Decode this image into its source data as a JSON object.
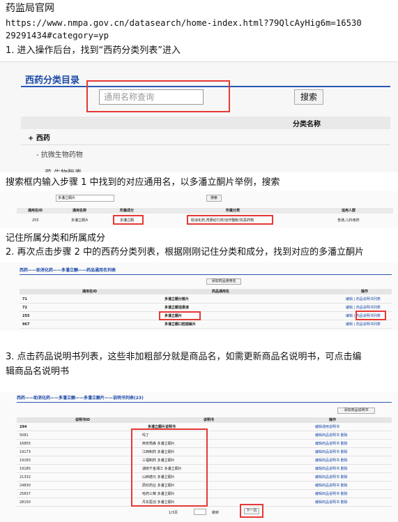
{
  "header": {
    "title": "药监局官网",
    "url_line1": "https://www.nmpa.gov.cn/datasearch/home-index.html?79QlcAyHig6m=16530",
    "url_line2": "29291434#category=yp"
  },
  "steps": {
    "step1": "1. 进入操作后台，找到“西药分类列表”进入",
    "search_note": "搜索框内输入步骤 1 中找到的对应通用名，以多潘立酮片举例，搜索",
    "remember_note": "记住所属分类和所属成分",
    "step2": "2. 再次点击步骤 2 中的西药分类列表，根据刚刚记住分类和成分，找到对应的多潘立酮片",
    "step3_line1": "3. 点击药品说明书列表，这些非加粗部分就是商品名，如需更新商品名说明书，可点击编",
    "step3_line2": "辑商品名说明书"
  },
  "shot1": {
    "title": "西药分类目录",
    "search_placeholder": "通用名称查询",
    "search_button": "搜索",
    "column_header": "分类名称",
    "tree_root": "+ 西药",
    "tree_child": "- 抗微生物药物",
    "tree_cut": "菜    生物酶素"
  },
  "shot2": {
    "search_value": "多潘立酮片",
    "search_button": "搜索",
    "headers": [
      "通用名ID",
      "通用名称",
      "所属成分",
      "所属分类",
      "适用人群"
    ],
    "row": [
      "255",
      "多潘立酮片",
      "多潘立酮",
      "助消化药,胃肠动力药/治疗腹胀/抗恶药物",
      "普通,儿科用药"
    ]
  },
  "shot3": {
    "breadcrumb": "西药——助消化药——多潘立酮——药品通用名列表",
    "add_button": "添加药品通用名",
    "headers": [
      "通用名ID",
      "药品通用名",
      "操作"
    ],
    "rows": [
      {
        "id": "71",
        "name": "多潘立酮分散片",
        "ops": "编辑 | 药品说明书列表"
      },
      {
        "id": "72",
        "name": "多潘立酮混悬液",
        "ops": "编辑 | 药品说明书列表"
      },
      {
        "id": "255",
        "name": "多潘立酮片",
        "ops": "编辑 | 药品说明书列表"
      },
      {
        "id": "967",
        "name": "多潘立酮口腔崩解片",
        "ops": "编辑 | 药品说明书列表"
      }
    ]
  },
  "shot4": {
    "breadcrumb": "西药——助消化药——多潘立酮——多潘立酮片——说明书列表(23)",
    "add_button": "添加商品说明书",
    "headers": [
      "说明书ID",
      "说明书",
      "操作"
    ],
    "first_row": {
      "id": "294",
      "name": "多潘立酮片说明书",
      "ops": "编辑通用说明书"
    },
    "rows": [
      {
        "id": "5081",
        "name": "吗丁",
        "ops": "编辑商品说明书  删除"
      },
      {
        "id": "16855",
        "name": "西安杨森 多潘立酮片",
        "ops": "编辑商品说明书  删除"
      },
      {
        "id": "19173",
        "name": "江西制药 多潘立酮片",
        "ops": "编辑商品说明书  删除"
      },
      {
        "id": "19183",
        "name": "三福制药 多潘立酮片",
        "ops": "编辑商品说明书  删除"
      },
      {
        "id": "19185",
        "name": "湖南千金湘江 多潘立酮片",
        "ops": "编辑商品说明书  删除"
      },
      {
        "id": "21332",
        "name": "山西德元 多潘立酮片",
        "ops": "编辑商品说明书  删除"
      },
      {
        "id": "24830",
        "name": "辰欣药业 多潘立酮片",
        "ops": "编辑商品说明书  删除"
      },
      {
        "id": "25837",
        "name": "哈药三精 多潘立酮片",
        "ops": "编辑商品说明书  删除"
      },
      {
        "id": "28150",
        "name": "丹东医创 多潘立酮片",
        "ops": "编辑商品说明书  删除"
      }
    ],
    "pager_text": "1/3页",
    "jump_button": "跳转",
    "next_button": "下一页"
  }
}
